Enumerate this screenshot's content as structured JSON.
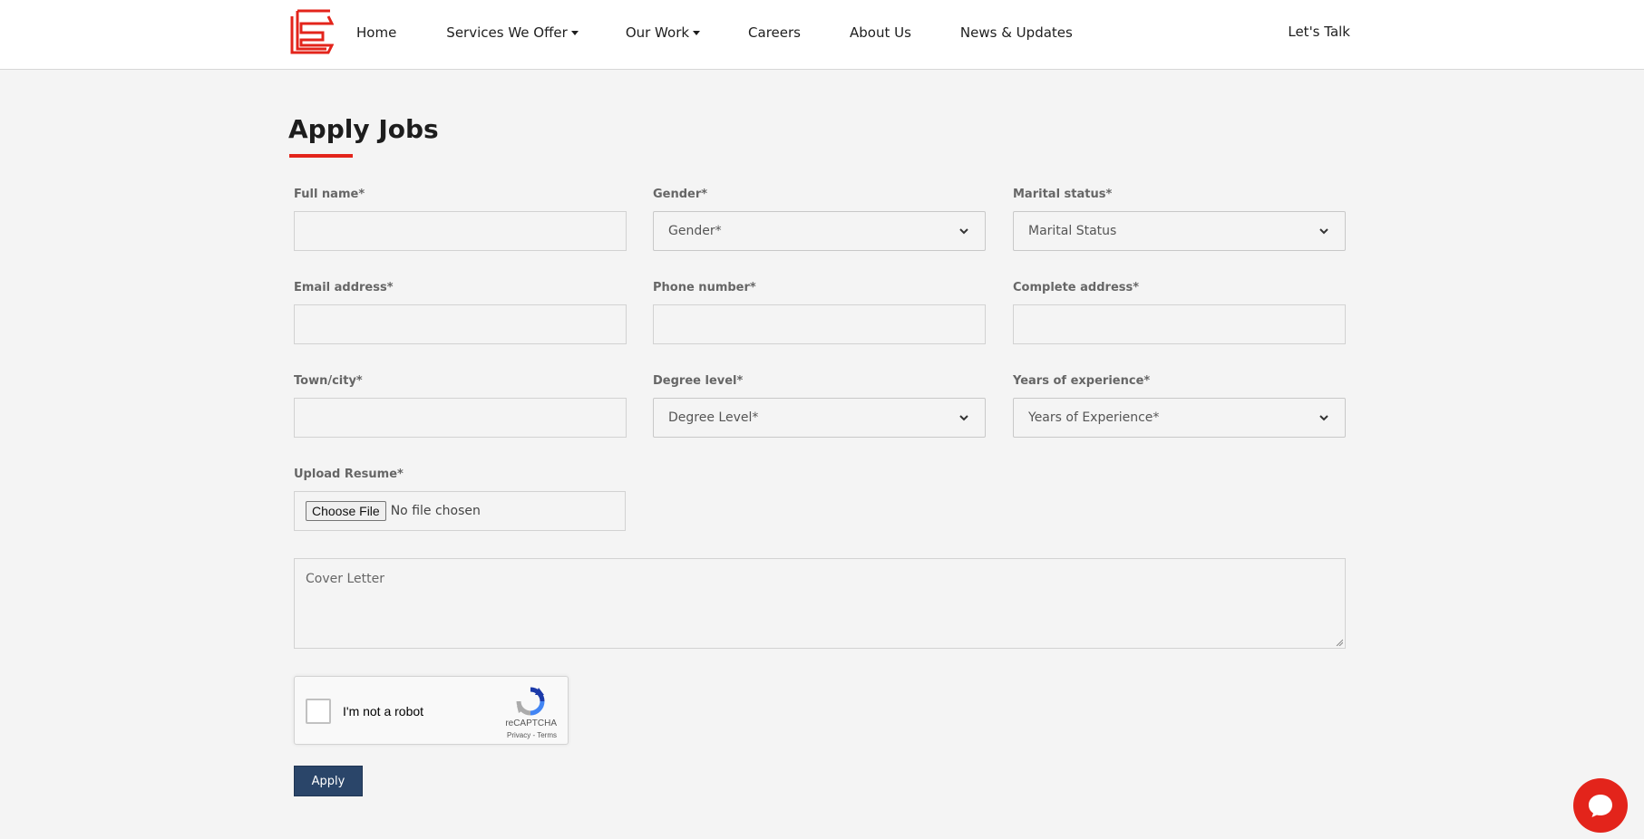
{
  "nav": {
    "items": [
      {
        "label": "Home",
        "has_dropdown": false
      },
      {
        "label": "Services We Offer",
        "has_dropdown": true
      },
      {
        "label": "Our Work",
        "has_dropdown": true
      },
      {
        "label": "Careers",
        "has_dropdown": false
      },
      {
        "label": "About Us",
        "has_dropdown": false
      },
      {
        "label": "News & Updates",
        "has_dropdown": false
      }
    ],
    "cta": "Let's Talk"
  },
  "page": {
    "title": "Apply Jobs"
  },
  "form": {
    "full_name": {
      "label": "Full name*",
      "value": ""
    },
    "gender": {
      "label": "Gender*",
      "selected": "Gender*"
    },
    "marital_status": {
      "label": "Marital status*",
      "selected": "Marital Status"
    },
    "email": {
      "label": "Email address*",
      "value": ""
    },
    "phone": {
      "label": "Phone number*",
      "value": ""
    },
    "address": {
      "label": "Complete address*",
      "value": ""
    },
    "town": {
      "label": "Town/city*",
      "value": ""
    },
    "degree": {
      "label": "Degree level*",
      "selected": "Degree Level*"
    },
    "experience": {
      "label": "Years of experience*",
      "selected": "Years of Experience*"
    },
    "resume": {
      "label": "Upload Resume*",
      "button": "Choose File",
      "status": "No file chosen"
    },
    "cover_letter": {
      "placeholder": "Cover Letter"
    },
    "submit": "Apply"
  },
  "captcha": {
    "text": "I'm not a robot",
    "brand": "reCAPTCHA",
    "links": "Privacy - Terms"
  },
  "colors": {
    "accent": "#e3241b",
    "button": "#2a4569",
    "background": "#f4f4f4"
  },
  "icons": {
    "logo": "company-logo-icon",
    "chat": "chat-bubble-icon",
    "select_arrow": "chevron-down-icon"
  }
}
